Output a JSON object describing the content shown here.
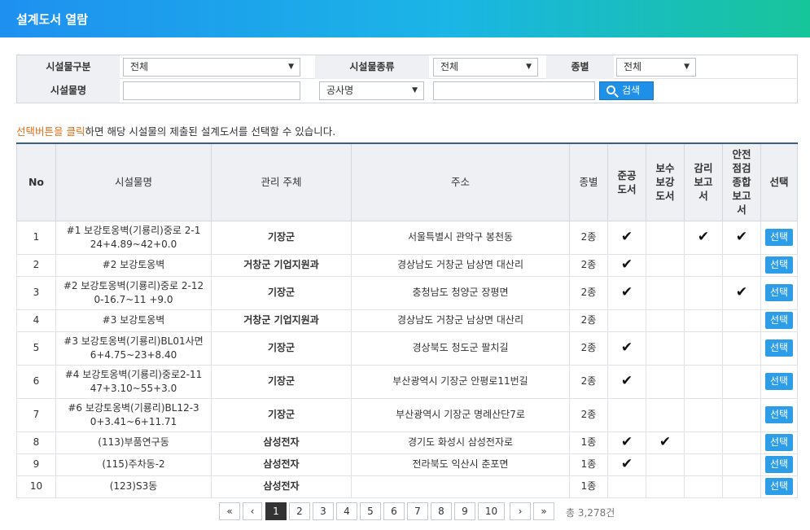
{
  "header": {
    "title": "설계도서 열람"
  },
  "filter": {
    "facility_type_label": "시설물구분",
    "facility_type_value": "전체",
    "facility_kind_label": "시설물종류",
    "facility_kind_value": "전체",
    "grade_label": "종별",
    "grade_value": "전체",
    "facility_name_label": "시설물명",
    "facility_name_value": "",
    "project_select_value": "공사명",
    "project_input_value": "",
    "search_label": "검색"
  },
  "notice": {
    "highlight": "선택버튼을 클릭",
    "rest": "하면 해당 시설물의 제출된 설계도서를 선택할 수 있습니다."
  },
  "table": {
    "headers": {
      "no": "No",
      "name": "시설물명",
      "manager": "관리 주체",
      "address": "주소",
      "grade": "종별",
      "completion": "준공\n도서",
      "reinforce": "보수\n보강\n도서",
      "supervision": "감리\n보고\n서",
      "safety": "안전\n점검\n종합\n보고\n서",
      "select": "선택"
    },
    "check_mark": "✔",
    "select_label": "선택",
    "rows": [
      {
        "no": "1",
        "name": "#1 보강토옹벽(기룡리)중로 2-1\n24+4.89~42+0.0",
        "manager": "기장군",
        "address": "서울특별시 관악구 봉천동",
        "grade": "2종",
        "completion": true,
        "reinforce": false,
        "supervision": true,
        "safety": true
      },
      {
        "no": "2",
        "name": "#2 보강토옹벽",
        "manager": "거창군 기업지원과",
        "address": "경상남도 거창군 남상면 대산리",
        "grade": "2종",
        "completion": true,
        "reinforce": false,
        "supervision": false,
        "safety": false
      },
      {
        "no": "3",
        "name": "#2 보강토옹벽(기룡리)중로 2-12\n0-16.7~11 +9.0",
        "manager": "기장군",
        "address": "충청남도 청양군 장평면",
        "grade": "2종",
        "completion": true,
        "reinforce": false,
        "supervision": false,
        "safety": true
      },
      {
        "no": "4",
        "name": "#3 보강토옹벽",
        "manager": "거창군 기업지원과",
        "address": "경상남도 거창군 남상면 대산리",
        "grade": "2종",
        "completion": false,
        "reinforce": false,
        "supervision": false,
        "safety": false
      },
      {
        "no": "5",
        "name": "#3 보강토옹벽(기룡리)BL01사면\n6+4.75~23+8.40",
        "manager": "기장군",
        "address": "경상북도 청도군 팔치길",
        "grade": "2종",
        "completion": true,
        "reinforce": false,
        "supervision": false,
        "safety": false
      },
      {
        "no": "6",
        "name": "#4 보강토옹벽(기룡리)중로2-11\n47+3.10~55+3.0",
        "manager": "기장군",
        "address": "부산광역시 기장군 안평로11번길",
        "grade": "2종",
        "completion": true,
        "reinforce": false,
        "supervision": false,
        "safety": false
      },
      {
        "no": "7",
        "name": "#6 보강토옹벽(기룡리)BL12-3\n0+3.41~6+11.71",
        "manager": "기장군",
        "address": "부산광역시 기장군 명례산단7로",
        "grade": "2종",
        "completion": false,
        "reinforce": false,
        "supervision": false,
        "safety": false
      },
      {
        "no": "8",
        "name": "(113)부품연구동",
        "manager": "삼성전자",
        "address": "경기도 화성시 삼성전자로",
        "grade": "1종",
        "completion": true,
        "reinforce": true,
        "supervision": false,
        "safety": false
      },
      {
        "no": "9",
        "name": "(115)주차동-2",
        "manager": "삼성전자",
        "address": "전라북도 익산시 춘포면",
        "grade": "1종",
        "completion": true,
        "reinforce": false,
        "supervision": false,
        "safety": false
      },
      {
        "no": "10",
        "name": "(123)S3동",
        "manager": "삼성전자",
        "address": "",
        "grade": "1종",
        "completion": false,
        "reinforce": false,
        "supervision": false,
        "safety": false
      }
    ]
  },
  "pagination": {
    "first": "«",
    "prev": "‹",
    "pages": [
      "1",
      "2",
      "3",
      "4",
      "5",
      "6",
      "7",
      "8",
      "9",
      "10"
    ],
    "active_page": "1",
    "next": "›",
    "last": "»",
    "total": "총 3,278건"
  }
}
